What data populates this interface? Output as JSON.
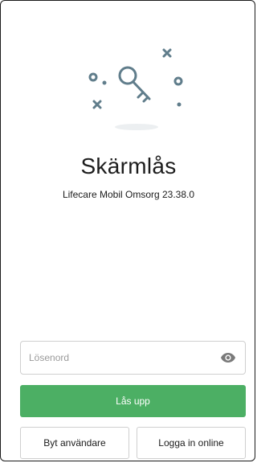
{
  "screen": {
    "title": "Skärmlås",
    "subtitle": "Lifecare Mobil Omsorg 23.38.0"
  },
  "password": {
    "placeholder": "Lösenord",
    "value": "",
    "toggle_icon": "eye-icon"
  },
  "actions": {
    "unlock_label": "Lås upp",
    "switch_user_label": "Byt användare",
    "login_online_label": "Logga in online"
  },
  "colors": {
    "primary": "#4caf64",
    "illustration": "#607d8b"
  }
}
